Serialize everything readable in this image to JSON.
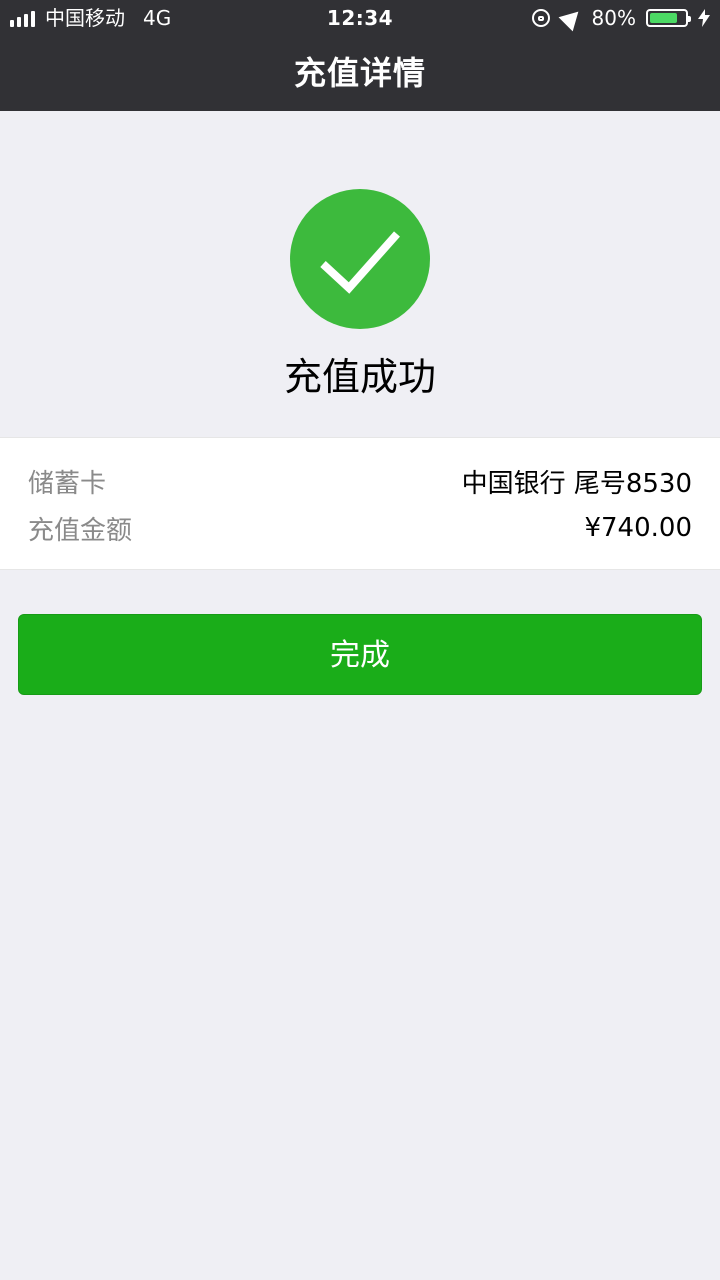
{
  "status_bar": {
    "carrier": "中国移动",
    "network": "4G",
    "time": "12:34",
    "battery_percent": "80%",
    "battery_level": 0.8,
    "icons": [
      "signal-bars-icon",
      "orientation-lock-icon",
      "location-arrow-icon",
      "battery-icon",
      "charging-bolt-icon"
    ]
  },
  "nav": {
    "title": "充值详情"
  },
  "result": {
    "status_text": "充值成功",
    "icon": "checkmark-icon"
  },
  "details": {
    "card_label": "储蓄卡",
    "card_value": "中国银行 尾号8530",
    "amount_label": "充值金额",
    "amount_value": "¥740.00"
  },
  "actions": {
    "done_label": "完成"
  },
  "colors": {
    "header_bg": "#313135",
    "page_bg": "#efeff4",
    "success_green": "#3dba3d",
    "button_green": "#1aad19"
  }
}
